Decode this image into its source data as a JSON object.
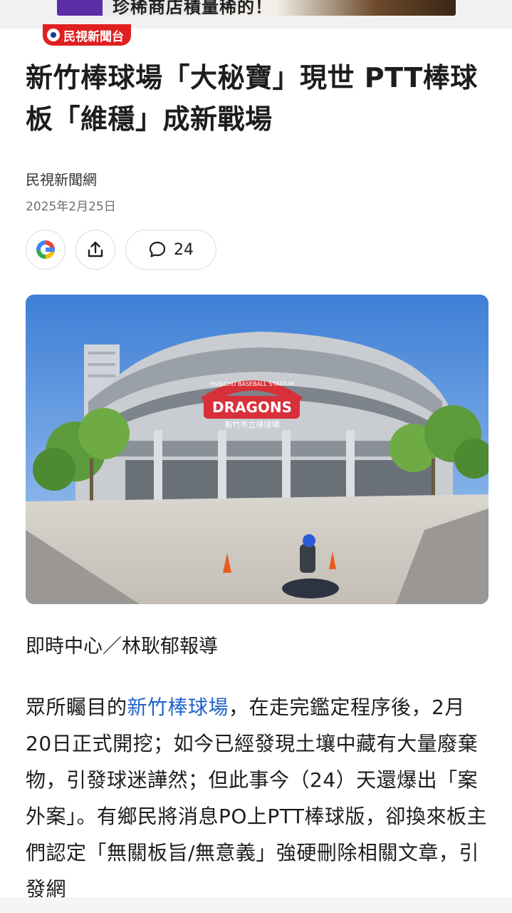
{
  "ad": {
    "text": "珍稀商店積量稀的！"
  },
  "source_logo": {
    "label": "民視新聞台"
  },
  "article": {
    "headline": "新竹棒球場「大秘寶」現世 PTT棒球板「維穩」成新戰場",
    "publisher": "民視新聞網",
    "date": "2025年2月25日",
    "comment_count": "24",
    "image_sign_text": "新竹市立棒球場",
    "image_sign_brand": "DRAGONS",
    "image_sign_arc": "HSINCHU BASEBALL STADIUM",
    "byline": "即時中心／林耿郁報導",
    "body": {
      "prefix": "眾所矚目的",
      "link": "新竹棒球場",
      "rest": "，在走完鑑定程序後，2月20日正式開挖；如今已經發現土壤中藏有大量廢棄物，引發球迷譁然；但此事今（24）天還爆出「案外案」。有鄉民將消息PO上PTT棒球版，卻換來板主們認定「無關板旨/無意義」強硬刪除相關文章，引發網"
    }
  },
  "colors": {
    "link": "#1e62c9",
    "source_red": "#e02020"
  }
}
